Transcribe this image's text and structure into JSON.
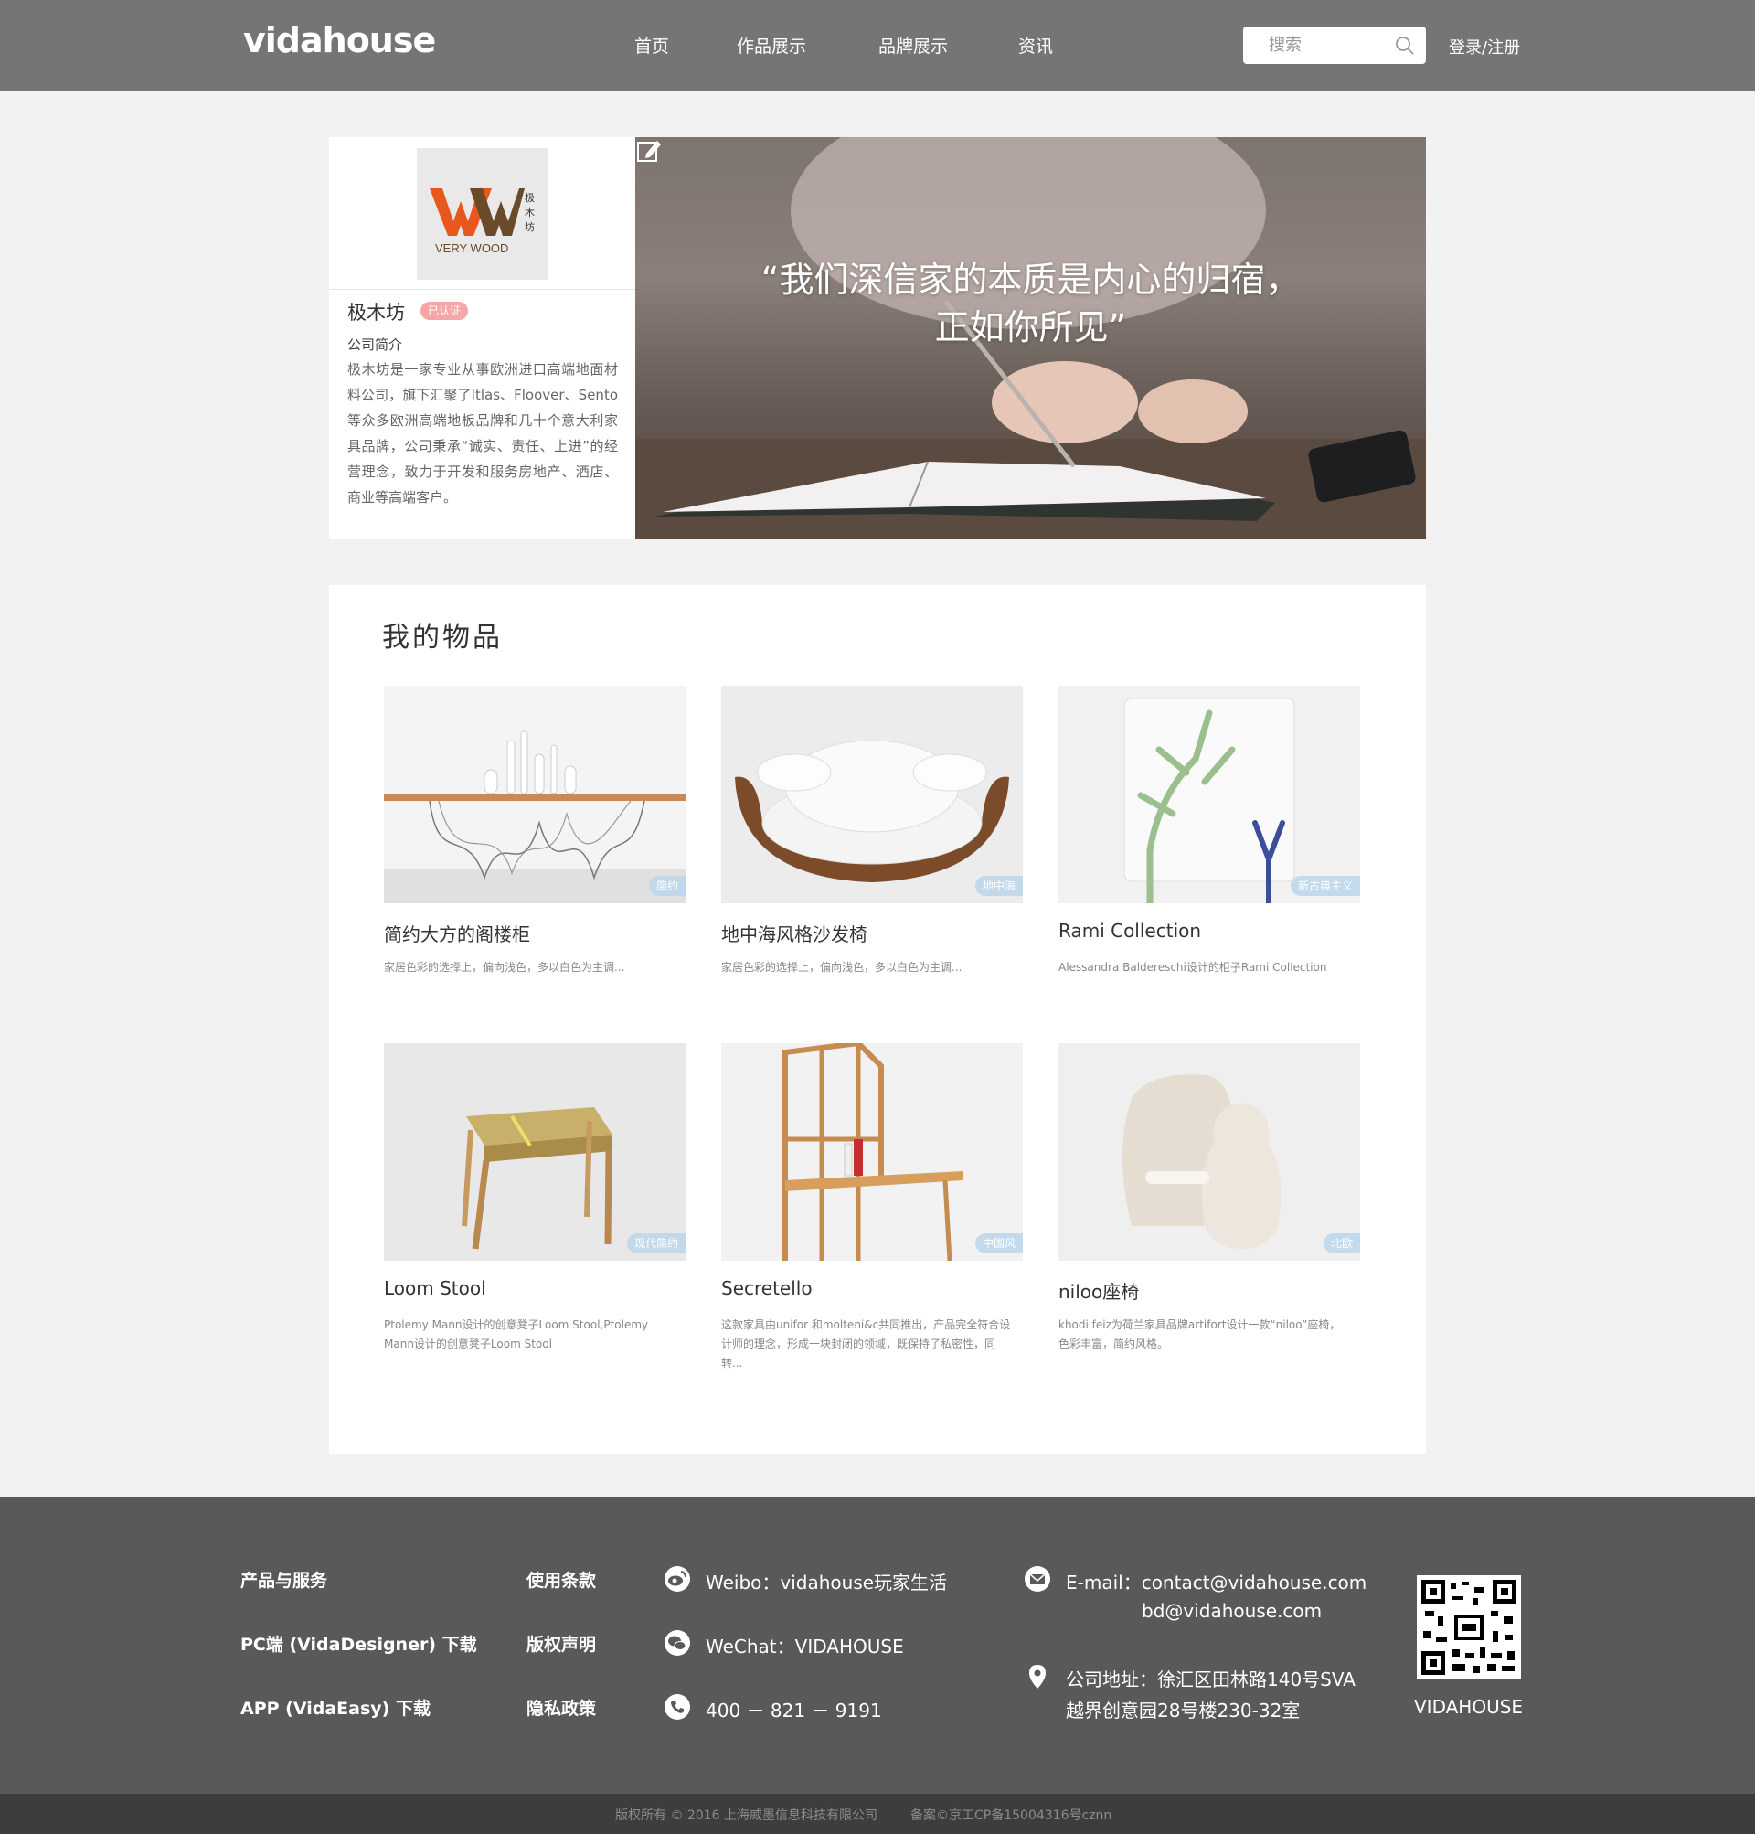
{
  "header": {
    "logo": "vidahouse",
    "nav": [
      "首页",
      "作品展示",
      "品牌展示",
      "资讯"
    ],
    "search_placeholder": "搜索",
    "login": "登录/注册"
  },
  "profile": {
    "logo_mark": "VW",
    "logo_text": "VERY WOOD",
    "logo_cn": "极木坊",
    "name": "极木坊",
    "badge": "已认证",
    "intro_label": "公司简介",
    "intro": "极木坊是一家专业从事欧洲进口高端地面材料公司，旗下汇聚了Itlas、Floover、Sento等众多欧洲高端地板品牌和几十个意大利家具品牌，公司秉承“诚实、责任、上进”的经营理念，致力于开发和服务房地产、酒店、商业等高端客户。",
    "quote_line1": "“我们深信家的本质是内心的归宿，",
    "quote_line2": "正如你所见”"
  },
  "items": {
    "title": "我的物品",
    "list": [
      {
        "title": "简约大方的阁楼柜",
        "desc": "家居色彩的选择上，偏向浅色，多以白色为主调...",
        "tag": "简约",
        "icon": "table-image"
      },
      {
        "title": "地中海风格沙发椅",
        "desc": "家居色彩的选择上，偏向浅色，多以白色为主调...",
        "tag": "地中海",
        "icon": "armchair-image"
      },
      {
        "title": "Rami Collection",
        "desc": "Alessandra Baldereschi设计的柜子Rami Collection",
        "tag": "新古典主义",
        "icon": "cabinet-image"
      },
      {
        "title": "Loom Stool",
        "desc": "Ptolemy Mann设计的创意凳子Loom Stool,Ptolemy Mann设计的创意凳子Loom Stool",
        "tag": "现代简约",
        "icon": "stool-image"
      },
      {
        "title": "Secretello",
        "desc": "这款家具由unifor 和molteni&c共同推出，产品完全符合设计师的理念，形成一块封闭的领域，既保持了私密性，同转...",
        "tag": "中国风",
        "icon": "desk-image"
      },
      {
        "title": "niloo座椅",
        "desc": "khodi feiz为荷兰家具品牌artifort设计一款“niloo”座椅，色彩丰富，简约风格。",
        "tag": "北欧",
        "icon": "chair-image"
      }
    ]
  },
  "footer": {
    "col1": [
      "产品与服务",
      "PC端 (VidaDesigner) 下载",
      "APP (VidaEasy) 下载"
    ],
    "col2": [
      "使用条款",
      "版权声明",
      "隐私政策"
    ],
    "weibo": "Weibo：vidahouse玩家生活",
    "wechat": "WeChat：VIDAHOUSE",
    "phone": "400 － 821 － 9191",
    "email_line1": "E-mail：contact@vidahouse.com",
    "email_line2": "bd@vidahouse.com",
    "address_line1": "公司地址：徐汇区田林路140号SVA",
    "address_line2": "越界创意园28号楼230-32室",
    "qr_label": "VIDAHOUSE",
    "copyright": "版权所有 © 2016 上海威墨信息科技有限公司",
    "icp": "备案©京工CP备15004316号cznn"
  }
}
